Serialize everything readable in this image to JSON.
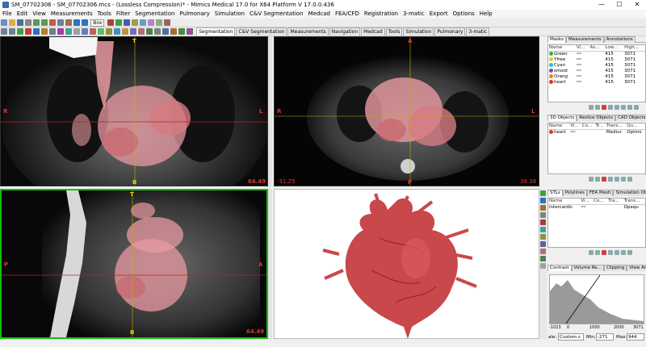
{
  "window": {
    "title": "SM_07702306 - SM_07702306.mcs - (Lossless Compression)* - Mimics Medical 17.0 for X64 Platform V 17.0.0.436",
    "minimize": "—",
    "maximize": "☐",
    "close": "✕"
  },
  "menu": [
    "File",
    "Edit",
    "View",
    "Measurements",
    "Tools",
    "Filter",
    "Segmentation",
    "Pulmonary",
    "Simulation",
    "C&V Segmentation",
    "Medcad",
    "FEA/CFD",
    "Registration",
    "3-matic",
    "Export",
    "Options",
    "Help"
  ],
  "toolbar": {
    "tool_combo": "Box",
    "project_tabs": [
      "Segmentation",
      "C&V Segmentation",
      "Measurements",
      "Navigation",
      "Medcad",
      "Tools",
      "Simulation",
      "Pulmonary",
      "3-matic"
    ],
    "active_tab": "Segmentation"
  },
  "views": {
    "coronal": {
      "top": "T",
      "bottom": "B",
      "left": "R",
      "right": "L",
      "zoom": "64.49"
    },
    "axial": {
      "top": "A",
      "bottom": "P",
      "left": "R",
      "right": "L",
      "left_val": "-31.25",
      "right_val": "39.38"
    },
    "sagittal": {
      "top": "T",
      "bottom": "B",
      "left": "P",
      "right": "A",
      "zoom": "64.49"
    }
  },
  "masks_panel": {
    "tabs": [
      "Masks",
      "Measurements",
      "Annotations"
    ],
    "columns": [
      "Name",
      "Vi...",
      "As...",
      "Low...",
      "High..."
    ],
    "rows": [
      {
        "name": "Green",
        "color": "#3cb043",
        "low": "415",
        "high": "3071"
      },
      {
        "name": "Yfree",
        "color": "#e0d020",
        "low": "415",
        "high": "3071"
      },
      {
        "name": "Cyan",
        "color": "#20c0d0",
        "low": "415",
        "high": "3071"
      },
      {
        "name": "smoot",
        "color": "#7050c0",
        "low": "415",
        "high": "3071"
      },
      {
        "name": "Orang",
        "color": "#f08020",
        "low": "415",
        "high": "3071"
      },
      {
        "name": "heart",
        "color": "#e03030",
        "low": "415",
        "high": "3071"
      }
    ]
  },
  "objects_panel": {
    "tabs": [
      "3D Objects",
      "Reslice Objects",
      "CAD Objects"
    ],
    "columns": [
      "Name",
      "Vi...",
      "Co...",
      "Tr...",
      "Trans...",
      "Qu..."
    ],
    "rows": [
      {
        "name": "heart",
        "trans": "Mediur",
        "qu": "Optimi"
      }
    ]
  },
  "stl_panel": {
    "tabs": [
      "STLs",
      "Polylines",
      "FEA Mesh",
      "Simulation Obje..."
    ],
    "columns": [
      "Name",
      "Vi...",
      "Co...",
      "Tra...",
      "Trans..."
    ],
    "rows": [
      {
        "name": "intercardic",
        "trans": "Opaqu"
      }
    ]
  },
  "contrast_panel": {
    "tabs": [
      "Contrast",
      "Volume Re...",
      "Clipping",
      "View Angles"
    ],
    "axis_ticks": [
      "-1023",
      "0",
      "1000",
      "2000",
      "3071"
    ],
    "scale_label": "ale:",
    "scale_value": "Custom s",
    "min_label": "Min:",
    "min_value": "-271",
    "max_label": "Max:",
    "max_value": "944"
  },
  "colors": {
    "accent_red": "#e83333",
    "yellow": "#e6d400",
    "selected_view": "#10c010",
    "mask_pink": "#e89aa0"
  }
}
